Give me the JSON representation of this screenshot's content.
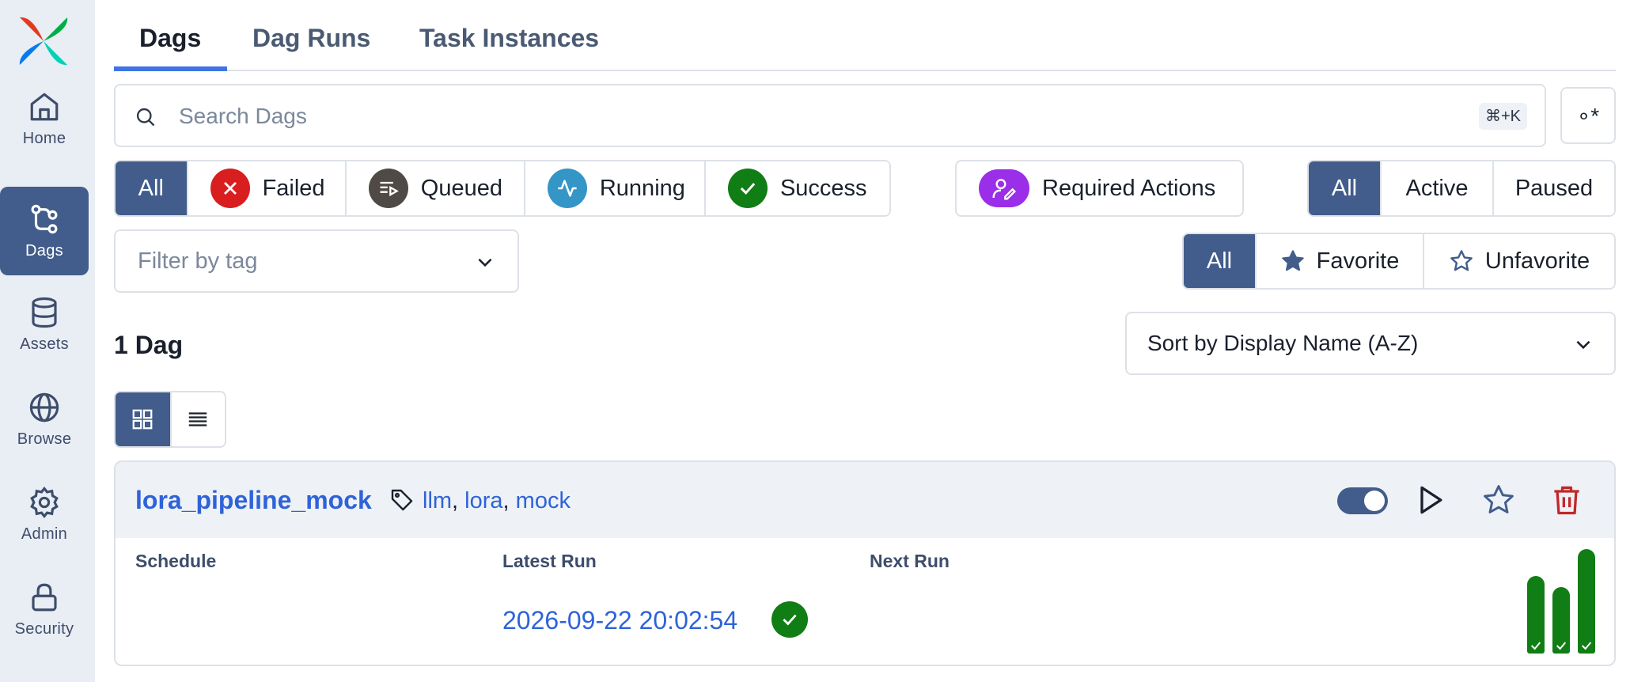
{
  "sidebar": {
    "items": [
      {
        "label": "Home"
      },
      {
        "label": "Dags"
      },
      {
        "label": "Assets"
      },
      {
        "label": "Browse"
      },
      {
        "label": "Admin"
      },
      {
        "label": "Security"
      }
    ],
    "active": "Dags"
  },
  "tabs": [
    "Dags",
    "Dag Runs",
    "Task Instances"
  ],
  "search": {
    "placeholder": "Search Dags",
    "value": "",
    "shortcut": "⌘+K",
    "regex_label": "∘*"
  },
  "state_filters": [
    {
      "label": "All"
    },
    {
      "label": "Failed",
      "color": "#d81e1e"
    },
    {
      "label": "Queued",
      "color": "#4f4a45"
    },
    {
      "label": "Running",
      "color": "#3495c7"
    },
    {
      "label": "Success",
      "color": "#107d15"
    }
  ],
  "required_actions": {
    "label": "Required Actions",
    "color": "#9b2ee8"
  },
  "active_filters": [
    "All",
    "Active",
    "Paused"
  ],
  "tag_filter": {
    "placeholder": "Filter by tag"
  },
  "favorite_filters": [
    "All",
    "Favorite",
    "Unfavorite"
  ],
  "count_label": "1 Dag",
  "sort": {
    "selected": "Sort by Display Name (A-Z)"
  },
  "dag": {
    "id": "lora_pipeline_mock",
    "tags": [
      "llm",
      "lora",
      "mock"
    ],
    "columns": {
      "schedule": "Schedule",
      "latest_run": "Latest Run",
      "next_run": "Next Run"
    },
    "latest_run": "2026-09-22 20:02:54",
    "paused": false,
    "recent_runs": [
      {
        "state": "success",
        "duration_fraction": 0.74
      },
      {
        "state": "success",
        "duration_fraction": 0.64
      },
      {
        "state": "success",
        "duration_fraction": 1.0
      }
    ]
  },
  "colors": {
    "accent": "#425d8b",
    "link": "#2e63d8",
    "success": "#107d15",
    "danger": "#c0282a"
  }
}
